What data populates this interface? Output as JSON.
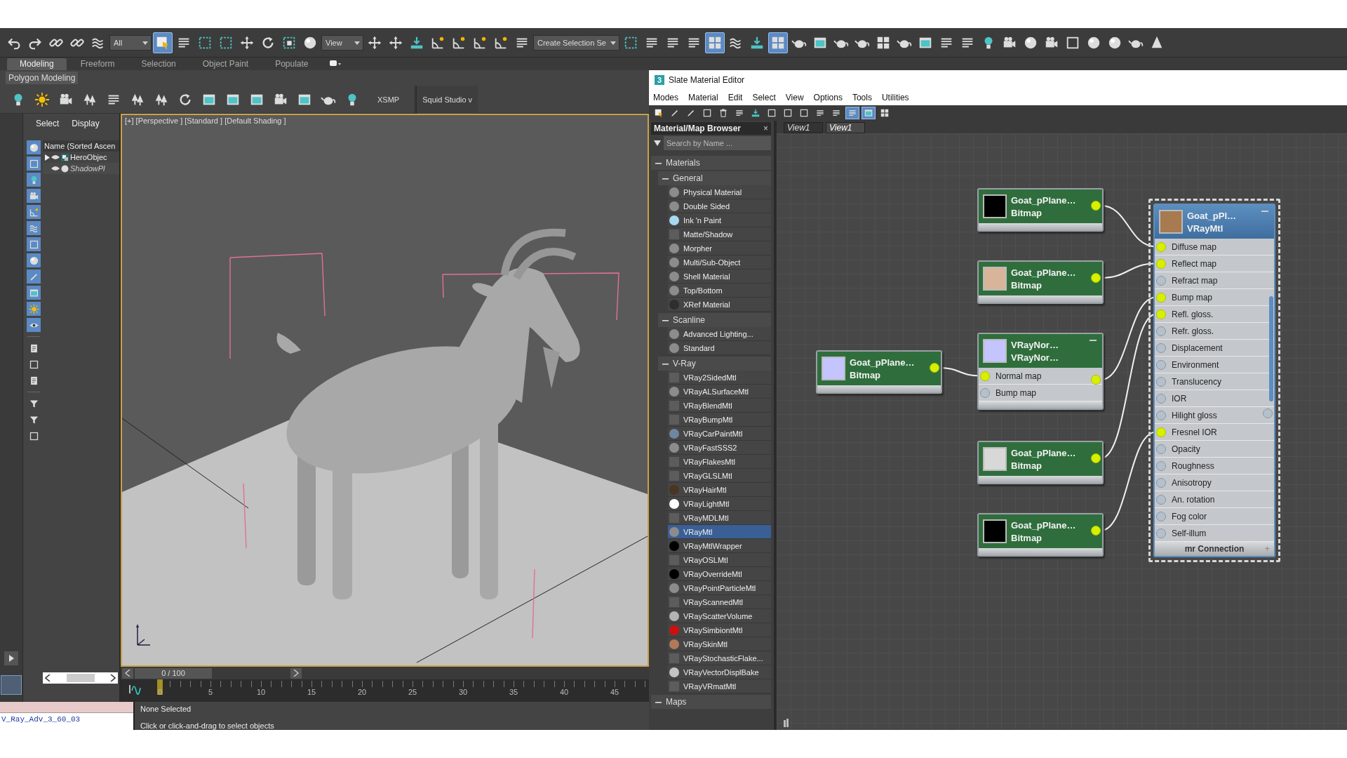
{
  "main_toolbar": [
    {
      "kind": "icon",
      "selected": false
    },
    {
      "kind": "icon",
      "selected": false
    },
    {
      "kind": "icon",
      "selected": false
    },
    {
      "kind": "icon",
      "selected": false
    },
    {
      "kind": "icon",
      "selected": false
    },
    {
      "kind": "dropdown",
      "value": "All"
    },
    {
      "kind": "icon",
      "selected": true
    },
    {
      "kind": "icon",
      "selected": false
    },
    {
      "kind": "icon",
      "selected": false
    },
    {
      "kind": "icon",
      "selected": false
    },
    {
      "kind": "icon",
      "selected": false
    },
    {
      "kind": "icon",
      "selected": false
    },
    {
      "kind": "icon",
      "selected": false
    },
    {
      "kind": "icon",
      "selected": false
    },
    {
      "kind": "dropdown",
      "value": "View"
    },
    {
      "kind": "icon",
      "selected": false
    },
    {
      "kind": "icon",
      "selected": false
    },
    {
      "kind": "icon",
      "selected": false
    },
    {
      "kind": "icon",
      "selected": false
    },
    {
      "kind": "icon",
      "selected": false
    },
    {
      "kind": "icon",
      "selected": false
    },
    {
      "kind": "icon",
      "selected": false
    },
    {
      "kind": "icon",
      "selected": false
    },
    {
      "kind": "dropdown",
      "value": "Create Selection Se"
    },
    {
      "kind": "icon",
      "selected": false
    },
    {
      "kind": "icon",
      "selected": false
    },
    {
      "kind": "icon",
      "selected": false
    },
    {
      "kind": "icon",
      "selected": false
    },
    {
      "kind": "icon",
      "selected": true
    },
    {
      "kind": "icon",
      "selected": false
    },
    {
      "kind": "icon",
      "selected": false
    },
    {
      "kind": "icon",
      "selected": true
    },
    {
      "kind": "icon",
      "selected": false
    },
    {
      "kind": "icon",
      "selected": false
    },
    {
      "kind": "icon",
      "selected": false
    },
    {
      "kind": "icon",
      "selected": false
    },
    {
      "kind": "icon",
      "selected": false
    },
    {
      "kind": "icon",
      "selected": false
    },
    {
      "kind": "icon",
      "selected": false
    },
    {
      "kind": "icon",
      "selected": false
    },
    {
      "kind": "icon",
      "selected": false
    },
    {
      "kind": "icon",
      "selected": false
    },
    {
      "kind": "icon",
      "selected": false
    },
    {
      "kind": "icon",
      "selected": false
    },
    {
      "kind": "icon",
      "selected": false
    },
    {
      "kind": "icon",
      "selected": false
    },
    {
      "kind": "icon",
      "selected": false
    },
    {
      "kind": "icon",
      "selected": false
    },
    {
      "kind": "icon",
      "selected": false
    },
    {
      "kind": "icon",
      "selected": false
    }
  ],
  "ribbon": {
    "tabs": [
      {
        "label": "Modeling",
        "selected": true
      },
      {
        "label": "Freeform",
        "selected": false
      },
      {
        "label": "Selection",
        "selected": false
      },
      {
        "label": "Object Paint",
        "selected": false
      },
      {
        "label": "Populate",
        "selected": false
      }
    ],
    "panel": "Polygon Modeling"
  },
  "create_toolbar": {
    "labels": [
      "XSMP",
      "Squid Studio v"
    ]
  },
  "command_panel": {
    "tabs": [
      "Select",
      "Display"
    ]
  },
  "explorer": {
    "column": "Name (Sorted Ascen",
    "filters": [
      {
        "on": true
      },
      {
        "on": true
      },
      {
        "on": true
      },
      {
        "on": true
      },
      {
        "on": true
      },
      {
        "on": true
      },
      {
        "on": true
      },
      {
        "on": true
      },
      {
        "on": true
      },
      {
        "on": true
      },
      {
        "on": true
      },
      {
        "on": true
      },
      {
        "on": false
      },
      {
        "on": false
      },
      {
        "on": false
      },
      {
        "on": false
      },
      {
        "on": false
      },
      {
        "on": false
      }
    ],
    "items": [
      {
        "label": "HeroObjec",
        "kind": "group",
        "expanded": false
      },
      {
        "label": "ShadowPl",
        "kind": "object"
      }
    ]
  },
  "viewport": {
    "label": "[+] [Perspective ] [Standard ] [Default Shading ]"
  },
  "time_slider": {
    "reading": "0 / 100",
    "level": 0
  },
  "timeline": {
    "ticks": [
      "0",
      "5",
      "10",
      "15",
      "20",
      "25",
      "30",
      "35",
      "40",
      "45"
    ]
  },
  "status": {
    "file": "V_Ray_Adv_3_60_03",
    "selection": "None Selected",
    "prompt": "Click or click-and-drag to select objects"
  },
  "material_editor": {
    "badge": "3",
    "title": "Slate Material Editor",
    "menu": [
      "Modes",
      "Material",
      "Edit",
      "Select",
      "View",
      "Options",
      "Tools",
      "Utilities"
    ],
    "toolbar": [
      {
        "selected": false
      },
      {
        "selected": false
      },
      {
        "selected": false
      },
      {
        "selected": false
      },
      {
        "selected": false
      },
      {
        "selected": false
      },
      {
        "selected": false
      },
      {
        "selected": false
      },
      {
        "selected": false
      },
      {
        "selected": false
      },
      {
        "selected": false
      },
      {
        "selected": false
      },
      {
        "selected": true
      },
      {
        "selected": true
      },
      {
        "selected": false
      }
    ],
    "browser": {
      "title": "Material/Map Browser",
      "close": "×",
      "search": {
        "placeholder": "Search by Name ..."
      },
      "groups": [
        {
          "label": "Materials",
          "expanded": true,
          "children": [
            {
              "label": "General",
              "expanded": true,
              "children": [
                {
                  "label": "Physical Material",
                  "kind": "sphere",
                  "color": "#8c8c8c",
                  "selected": false
                },
                {
                  "label": "Double Sided",
                  "kind": "sphere",
                  "color": "#8c8c8c",
                  "selected": false
                },
                {
                  "label": "Ink 'n Paint",
                  "kind": "sphere",
                  "color": "#a8d8ee",
                  "selected": false
                },
                {
                  "label": "Matte/Shadow",
                  "kind": "flat",
                  "color": "#5c5c5c",
                  "selected": false
                },
                {
                  "label": "Morpher",
                  "kind": "sphere",
                  "color": "#8c8c8c",
                  "selected": false
                },
                {
                  "label": "Multi/Sub-Object",
                  "kind": "sphere",
                  "color": "#8c8c8c",
                  "selected": false
                },
                {
                  "label": "Shell Material",
                  "kind": "sphere",
                  "color": "#8c8c8c",
                  "selected": false
                },
                {
                  "label": "Top/Bottom",
                  "kind": "sphere",
                  "color": "#8c8c8c",
                  "selected": false
                },
                {
                  "label": "XRef Material",
                  "kind": "sphere",
                  "color": "#2e2e2e",
                  "selected": false
                }
              ]
            },
            {
              "label": "Scanline",
              "expanded": true,
              "children": [
                {
                  "label": "Advanced Lighting...",
                  "kind": "sphere",
                  "color": "#8c8c8c",
                  "selected": false
                },
                {
                  "label": "Standard",
                  "kind": "sphere",
                  "color": "#8c8c8c",
                  "selected": false
                }
              ]
            },
            {
              "label": "V-Ray",
              "expanded": true,
              "children": [
                {
                  "label": "VRay2SidedMtl",
                  "kind": "flat",
                  "color": "#5c5c5c",
                  "selected": false
                },
                {
                  "label": "VRayALSurfaceMtl",
                  "kind": "sphere",
                  "color": "#8c8c8c",
                  "selected": false
                },
                {
                  "label": "VRayBlendMtl",
                  "kind": "flat",
                  "color": "#5c5c5c",
                  "selected": false
                },
                {
                  "label": "VRayBumpMtl",
                  "kind": "flat",
                  "color": "#5c5c5c",
                  "selected": false
                },
                {
                  "label": "VRayCarPaintMtl",
                  "kind": "sphere",
                  "color": "#6f86a0",
                  "selected": false
                },
                {
                  "label": "VRayFastSSS2",
                  "kind": "sphere",
                  "color": "#8c8c8c",
                  "selected": false
                },
                {
                  "label": "VRayFlakesMtl",
                  "kind": "flat",
                  "color": "#5c5c5c",
                  "selected": false
                },
                {
                  "label": "VRayGLSLMtl",
                  "kind": "flat",
                  "color": "#5c5c5c",
                  "selected": false
                },
                {
                  "label": "VRayHairMtl",
                  "kind": "sphere",
                  "color": "#4a3522",
                  "selected": false
                },
                {
                  "label": "VRayLightMtl",
                  "kind": "sphere",
                  "color": "#ffffff",
                  "selected": false
                },
                {
                  "label": "VRayMDLMtl",
                  "kind": "flat",
                  "color": "#5c5c5c",
                  "selected": false
                },
                {
                  "label": "VRayMtl",
                  "kind": "sphere",
                  "color": "#8c8c8c",
                  "selected": true
                },
                {
                  "label": "VRayMtlWrapper",
                  "kind": "sphere",
                  "color": "#000000",
                  "selected": false
                },
                {
                  "label": "VRayOSLMtl",
                  "kind": "flat",
                  "color": "#5c5c5c",
                  "selected": false
                },
                {
                  "label": "VRayOverrideMtl",
                  "kind": "sphere",
                  "color": "#000000",
                  "selected": false
                },
                {
                  "label": "VRayPointParticleMtl",
                  "kind": "sphere",
                  "color": "#8c8c8c",
                  "selected": false
                },
                {
                  "label": "VRayScannedMtl",
                  "kind": "flat",
                  "color": "#5c5c5c",
                  "selected": false
                },
                {
                  "label": "VRayScatterVolume",
                  "kind": "sphere",
                  "color": "#b4b4b4",
                  "selected": false
                },
                {
                  "label": "VRaySimbiontMtl",
                  "kind": "sphere",
                  "color": "#cc1010",
                  "selected": false
                },
                {
                  "label": "VRaySkinMtl",
                  "kind": "sphere",
                  "color": "#b07a5a",
                  "selected": false
                },
                {
                  "label": "VRayStochasticFlake...",
                  "kind": "flat",
                  "color": "#5c5c5c",
                  "selected": false
                },
                {
                  "label": "VRayVectorDisplBake",
                  "kind": "sphere",
                  "color": "#c4c4c4",
                  "selected": false
                },
                {
                  "label": "VRayVRmatMtl",
                  "kind": "flat",
                  "color": "#5c5c5c",
                  "selected": false
                }
              ]
            }
          ]
        },
        {
          "label": "Maps",
          "expanded": true
        }
      ]
    },
    "views": [
      {
        "label": "View1",
        "selected": false
      },
      {
        "label": "View1",
        "selected": true
      }
    ],
    "nodes": [
      {
        "kind": "map",
        "title": "Goat_pPlane…",
        "subtitle": "Bitmap",
        "color": "#000000",
        "selected": false
      },
      {
        "kind": "map",
        "title": "Goat_pPlane…",
        "subtitle": "Bitmap",
        "color": "#d8b49a",
        "selected": false
      },
      {
        "kind": "map",
        "title": "Goat_pPlane…",
        "subtitle": "Bitmap",
        "color": "#c4c4ff",
        "selected": false
      },
      {
        "kind": "map",
        "title": "VRayNor…",
        "subtitle": "VRayNor…",
        "color": "#c4c4ff",
        "selected": false,
        "collapsible": true,
        "slots": [
          {
            "label": "Normal map",
            "connected": true
          },
          {
            "label": "Bump map",
            "connected": false
          }
        ]
      },
      {
        "kind": "map",
        "title": "Goat_pPlane…",
        "subtitle": "Bitmap",
        "color": "#d8d8d8",
        "selected": false
      },
      {
        "kind": "map",
        "title": "Goat_pPlane…",
        "subtitle": "Bitmap",
        "color": "#000000",
        "selected": false
      },
      {
        "kind": "material",
        "title": "Goat_pPl…",
        "subtitle": "VRayMtl",
        "color": "#a87a50",
        "selected": true,
        "collapsible": true,
        "slots": [
          {
            "label": "Diffuse map",
            "connected": true
          },
          {
            "label": "Reflect map",
            "connected": true
          },
          {
            "label": "Refract map",
            "connected": false
          },
          {
            "label": "Bump map",
            "connected": true
          },
          {
            "label": "Refl. gloss.",
            "connected": true
          },
          {
            "label": "Refr. gloss.",
            "connected": false
          },
          {
            "label": "Displacement",
            "connected": false
          },
          {
            "label": "Environment",
            "connected": false
          },
          {
            "label": "Translucency",
            "connected": false
          },
          {
            "label": "IOR",
            "connected": false
          },
          {
            "label": "Hilight gloss",
            "connected": false
          },
          {
            "label": "Fresnel IOR",
            "connected": true
          },
          {
            "label": "Opacity",
            "connected": false
          },
          {
            "label": "Roughness",
            "connected": false
          },
          {
            "label": "Anisotropy",
            "connected": false
          },
          {
            "label": "An. rotation",
            "connected": false
          },
          {
            "label": "Fog color",
            "connected": false
          },
          {
            "label": "Self-illum",
            "connected": false
          }
        ],
        "footer": {
          "label": "mr Connection",
          "action": "+"
        }
      }
    ]
  }
}
